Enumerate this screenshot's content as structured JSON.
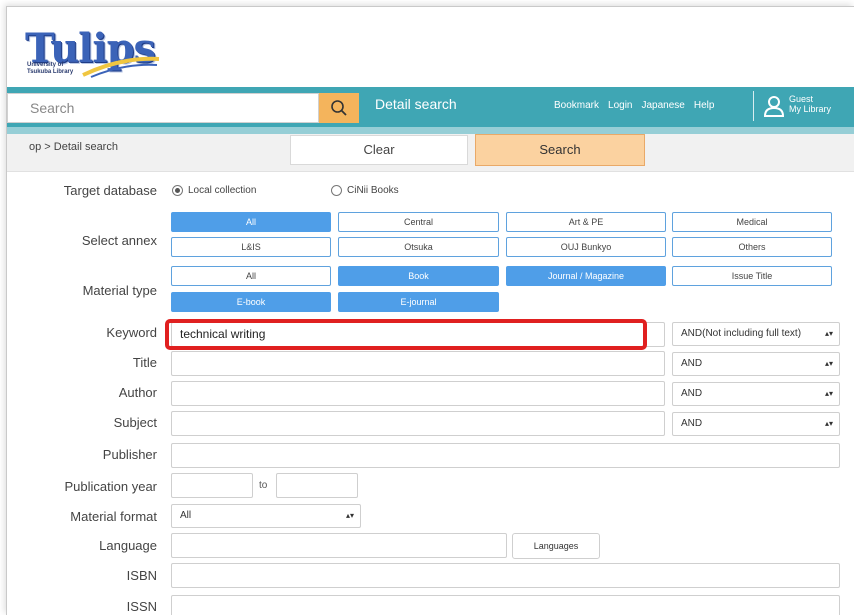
{
  "logo": {
    "name": "Tulips",
    "subtitle_line1": "University of",
    "subtitle_line2": "Tsukuba Library"
  },
  "topbar": {
    "search_placeholder": "Search",
    "detail_search": "Detail search",
    "links": [
      "Bookmark",
      "Login",
      "Japanese",
      "Help"
    ],
    "guest_line1": "Guest",
    "guest_line2": "My Library"
  },
  "breadcrumb": "op > Detail search",
  "buttons": {
    "clear": "Clear",
    "search": "Search"
  },
  "target_database": {
    "label": "Target database",
    "options": [
      "Local collection",
      "CiNii Books"
    ],
    "selected": "Local collection"
  },
  "select_annex": {
    "label": "Select annex",
    "options": [
      "All",
      "Central",
      "Art & PE",
      "Medical",
      "L&IS",
      "Otsuka",
      "OUJ Bunkyo",
      "Others"
    ],
    "selected": [
      "All"
    ]
  },
  "material_type": {
    "label": "Material type",
    "options": [
      "All",
      "Book",
      "Journal / Magazine",
      "Issue Title",
      "E-book",
      "E-journal"
    ],
    "selected": [
      "Book",
      "Journal / Magazine",
      "E-book",
      "E-journal"
    ]
  },
  "fields": {
    "keyword": {
      "label": "Keyword",
      "value": "technical writing",
      "operator": "AND(Not including full text)"
    },
    "title": {
      "label": "Title",
      "value": "",
      "operator": "AND"
    },
    "author": {
      "label": "Author",
      "value": "",
      "operator": "AND"
    },
    "subject": {
      "label": "Subject",
      "value": "",
      "operator": "AND"
    },
    "publisher": {
      "label": "Publisher",
      "value": ""
    },
    "publication_year": {
      "label": "Publication year",
      "from": "",
      "to_label": "to",
      "to": ""
    },
    "material_format": {
      "label": "Material format",
      "value": "All"
    },
    "language": {
      "label": "Language",
      "value": "",
      "button": "Languages"
    },
    "isbn": {
      "label": "ISBN",
      "value": ""
    },
    "issn": {
      "label": "ISSN"
    }
  },
  "colors": {
    "topbar": "#3fa6b4",
    "accent_orange": "#f4b45c",
    "chip_selected": "#4f9ee8",
    "highlight": "#e02020"
  }
}
